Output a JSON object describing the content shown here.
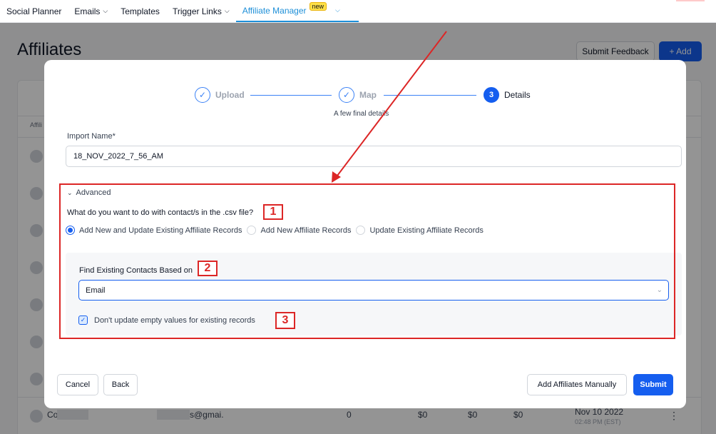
{
  "nav": {
    "items": [
      {
        "label": "Social Planner",
        "chevron": false
      },
      {
        "label": "Emails",
        "chevron": true
      },
      {
        "label": "Templates",
        "chevron": false
      },
      {
        "label": "Trigger Links",
        "chevron": true
      }
    ],
    "active": {
      "label": "Affiliate Manager",
      "badge": "new"
    }
  },
  "page": {
    "title": "Affiliates",
    "feedback_label": "Submit Feedback",
    "add_label": "+ Add",
    "table_col_head": "Affili",
    "bottom_row": {
      "name": "Co",
      "email": "s@gmai.",
      "count": "0",
      "amount1": "$0",
      "amount2": "$0",
      "amount3": "$0",
      "date": "Nov 10 2022",
      "time": "02:48 PM (EST)"
    }
  },
  "modal": {
    "steps": [
      {
        "label": "Upload",
        "state": "done"
      },
      {
        "label": "Map",
        "state": "done"
      },
      {
        "label": "Details",
        "state": "current",
        "number": "3"
      }
    ],
    "step_subtitle": "A few final details",
    "import_name_label": "Import Name*",
    "import_name_value": "18_NOV_2022_7_56_AM",
    "advanced_label": "Advanced",
    "question": "What do you want to do with contact/s in the .csv file?",
    "radio_options": [
      {
        "label": "Add New and Update Existing Affiliate Records",
        "checked": true
      },
      {
        "label": "Add New Affiliate Records",
        "checked": false
      },
      {
        "label": "Update Existing Affiliate Records",
        "checked": false
      }
    ],
    "find_label": "Find Existing Contacts Based on",
    "find_value": "Email",
    "checkbox_label": "Don't update empty values for existing records",
    "checkbox_checked": true,
    "buttons": {
      "cancel": "Cancel",
      "back": "Back",
      "add_manually": "Add Affiliates Manually",
      "submit": "Submit"
    }
  },
  "annotations": {
    "numbers": [
      "1",
      "2",
      "3"
    ],
    "color": "#dc2626"
  },
  "colors": {
    "primary": "#155eef",
    "nav_active": "#1d8fd8",
    "annotation_red": "#dc2626"
  }
}
